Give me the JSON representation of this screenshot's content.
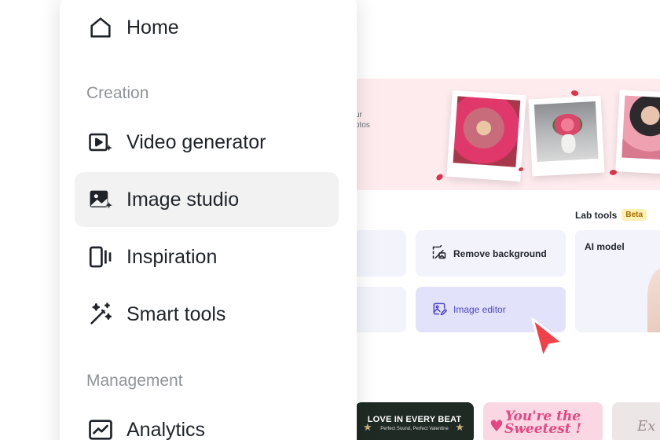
{
  "menu": {
    "items": [
      {
        "label": "Home",
        "icon": "home-icon"
      },
      {
        "label": "Video generator",
        "icon": "video-generator-icon"
      },
      {
        "label": "Image studio",
        "icon": "image-studio-icon",
        "active": true
      },
      {
        "label": "Inspiration",
        "icon": "inspiration-icon"
      },
      {
        "label": "Smart tools",
        "icon": "magic-wand-icon"
      },
      {
        "label": "Analytics",
        "icon": "analytics-icon"
      }
    ],
    "sections": {
      "creation": "Creation",
      "management": "Management"
    }
  },
  "banner": {
    "text_line1": "ur",
    "text_line2": "otos"
  },
  "lab_tools": {
    "label": "Lab tools",
    "badge": "Beta"
  },
  "tools": {
    "remove_background": "Remove background",
    "image_editor": "Image editor",
    "ai_model": "AI model"
  },
  "templates": {
    "dark_title": "LOVE IN EVERY BEAT",
    "dark_subtitle": "Perfect Sound, Perfect Valentine",
    "pink_line1": "You're the",
    "pink_line2": "Sweetest !",
    "soft_text": "Ex"
  },
  "colors": {
    "accent": "#4b46c8",
    "banner_bg": "#fdebee",
    "active_item_bg": "#f2f2f3",
    "cursor": "#f04148"
  }
}
